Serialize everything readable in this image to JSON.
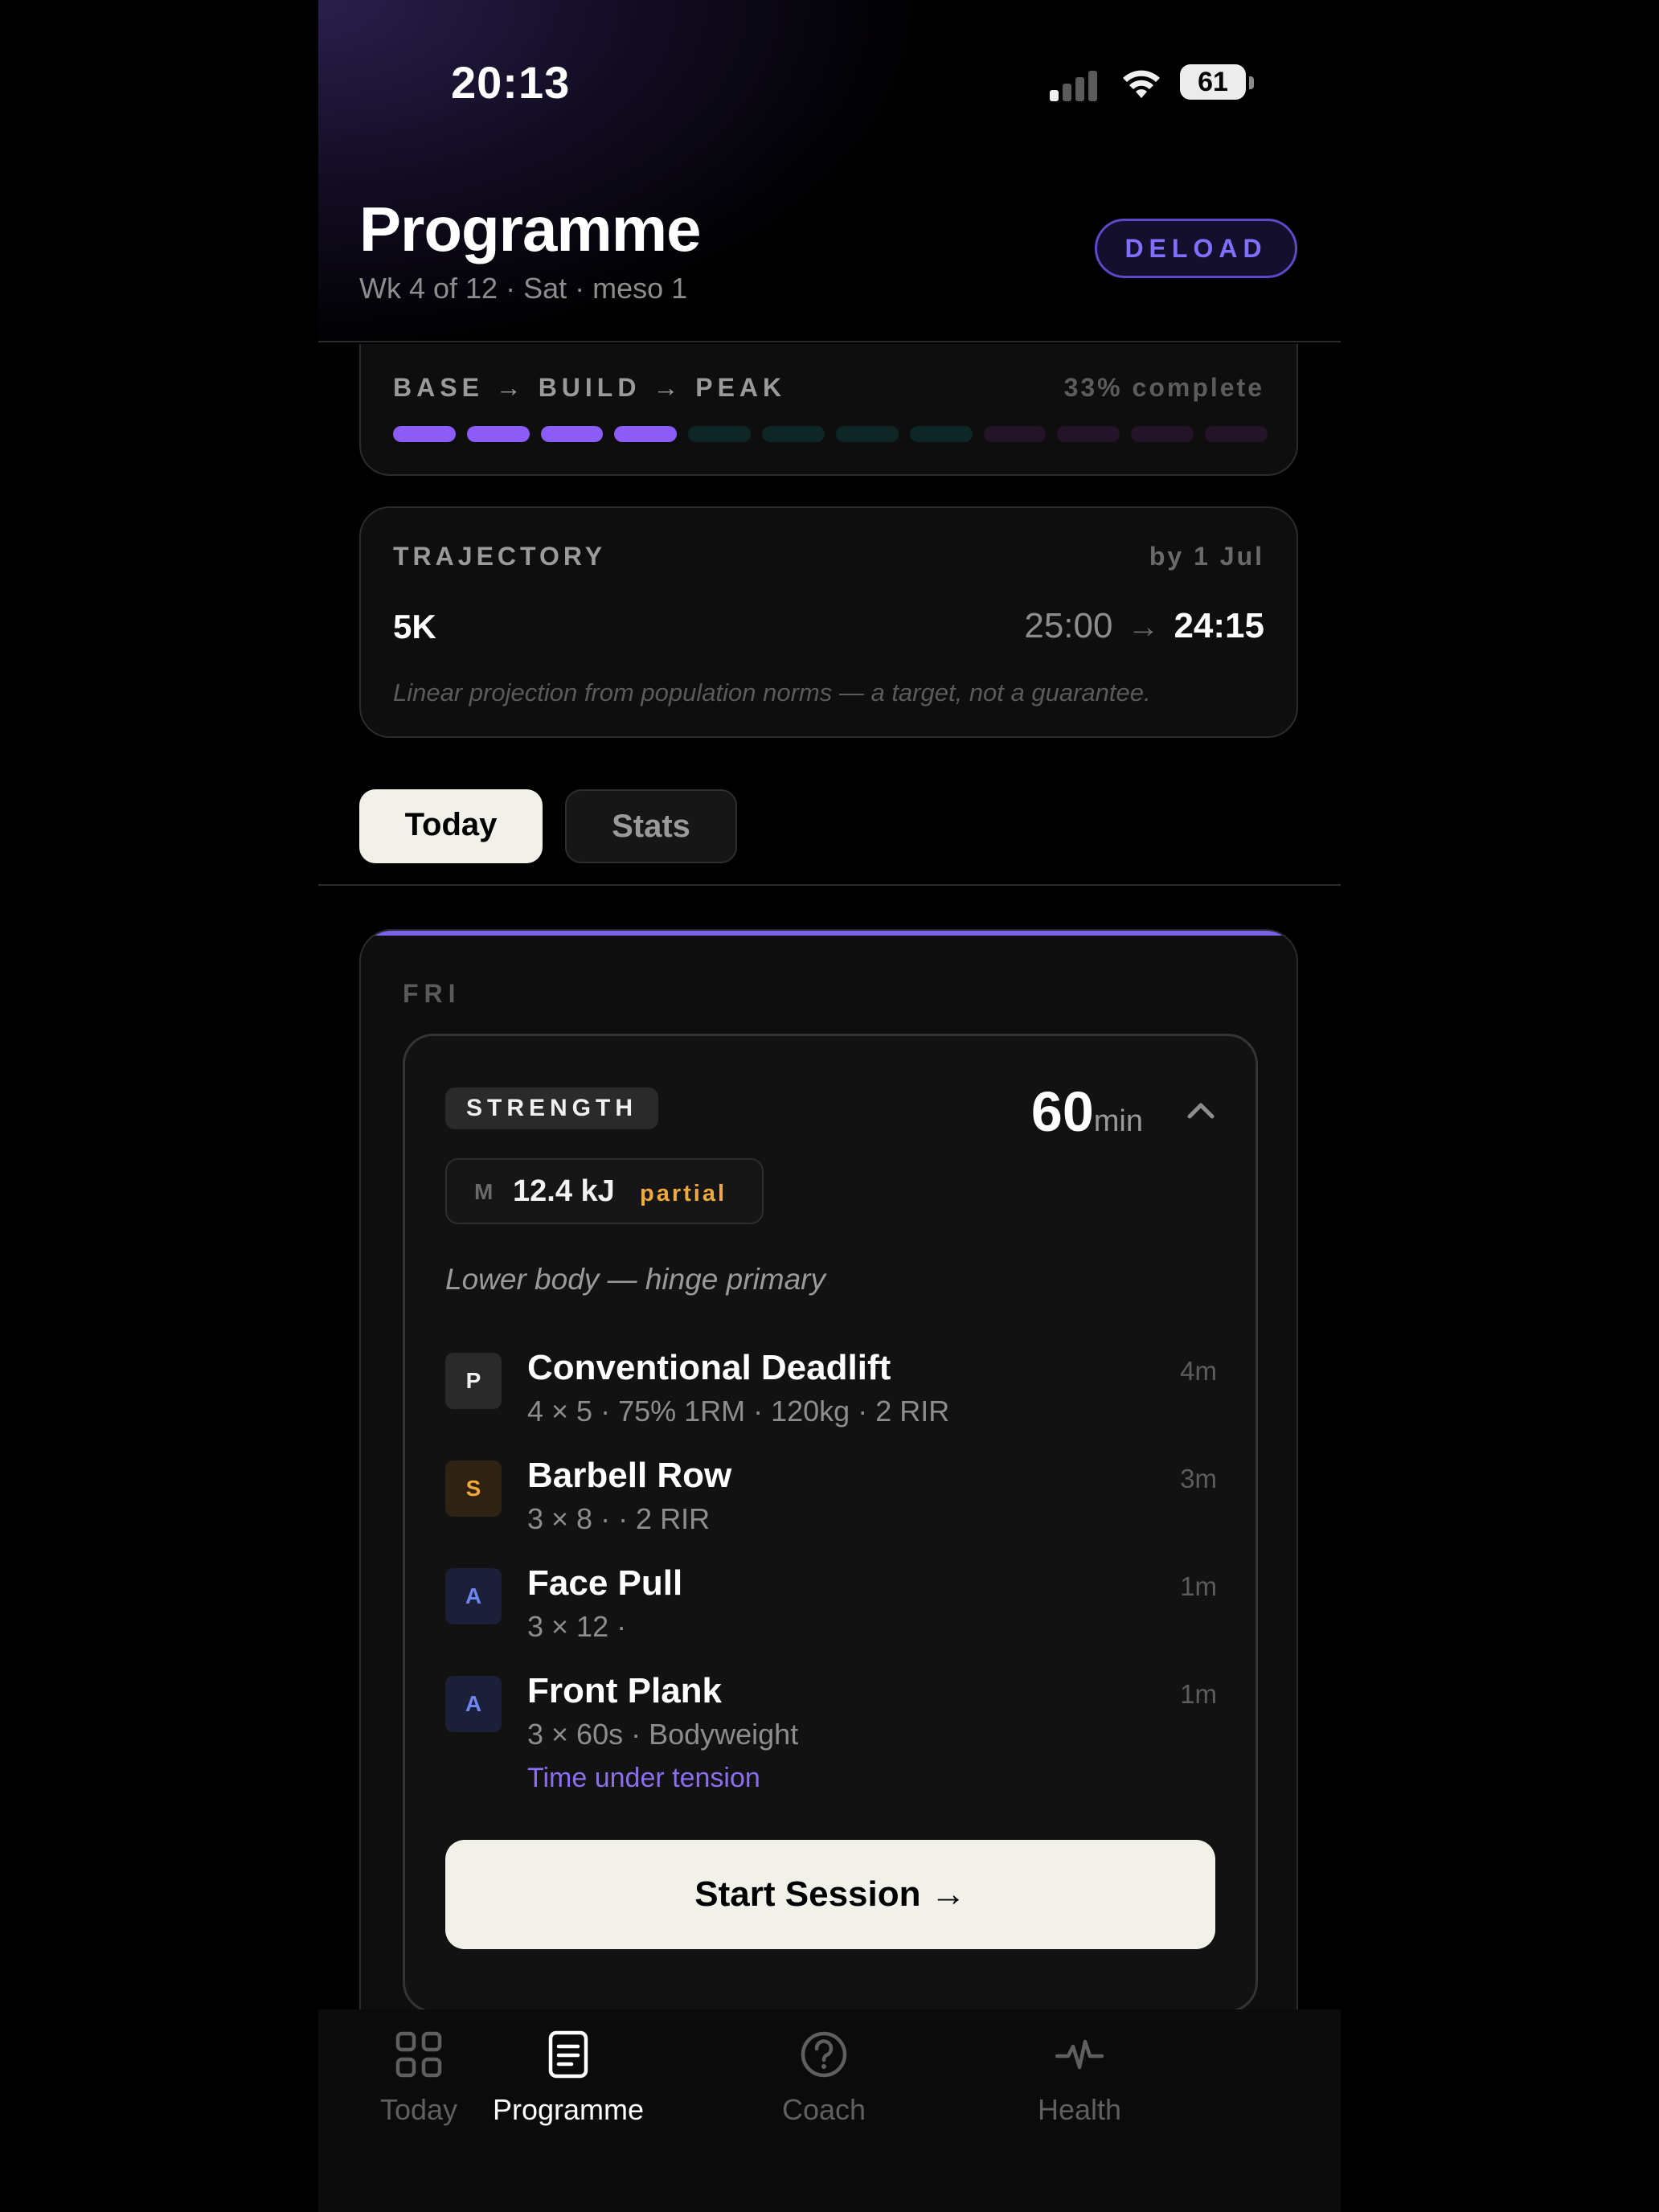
{
  "status_bar": {
    "time": "20:13",
    "battery": "61"
  },
  "header": {
    "title": "Programme",
    "subtitle": "Wk 4 of 12 · Sat · meso 1",
    "deload_label": "DELOAD"
  },
  "phase": {
    "label": "BASE → BUILD → PEAK",
    "progress_text": "33% complete",
    "weeks_total": 12,
    "weeks_done": 4,
    "colors": {
      "done": "#8b5cf6",
      "build": "#0f2626",
      "peak": "#241427"
    }
  },
  "trajectory": {
    "title": "TRAJECTORY",
    "by": "by 1 Jul",
    "event": "5K",
    "from": "25:00",
    "arrow": "→",
    "to": "24:15",
    "note": "Linear projection from population norms — a target, not a guarantee."
  },
  "tabs": {
    "today": "Today",
    "stats": "Stats"
  },
  "day": {
    "label": "FRI",
    "session": {
      "type": "STRENGTH",
      "duration_value": "60",
      "duration_unit": "min",
      "energy_prefix": "M",
      "energy_value": "12.4 kJ",
      "energy_flag": "partial",
      "focus": "Lower body — hinge primary",
      "exercises": [
        {
          "tag": "P",
          "name": "Conventional Deadlift",
          "detail": "4 × 5  ·  75% 1RM · 120kg  ·  2 RIR",
          "time": "4m",
          "note": ""
        },
        {
          "tag": "S",
          "name": "Barbell Row",
          "detail": "3 × 8  ·     ·  2 RIR",
          "time": "3m",
          "note": ""
        },
        {
          "tag": "A",
          "name": "Face Pull",
          "detail": "3 × 12  ·",
          "time": "1m",
          "note": ""
        },
        {
          "tag": "A",
          "name": "Front Plank",
          "detail": "3 × 60s  ·  Bodyweight",
          "time": "1m",
          "note": "Time under tension"
        }
      ],
      "start_label": "Start Session →"
    }
  },
  "tabbar": {
    "items": [
      {
        "label": "Today",
        "icon": "grid-icon"
      },
      {
        "label": "Programme",
        "icon": "document-icon"
      },
      {
        "label": "Coach",
        "icon": "help-circle-icon"
      },
      {
        "label": "Health",
        "icon": "pulse-icon"
      }
    ],
    "active": "Programme"
  }
}
